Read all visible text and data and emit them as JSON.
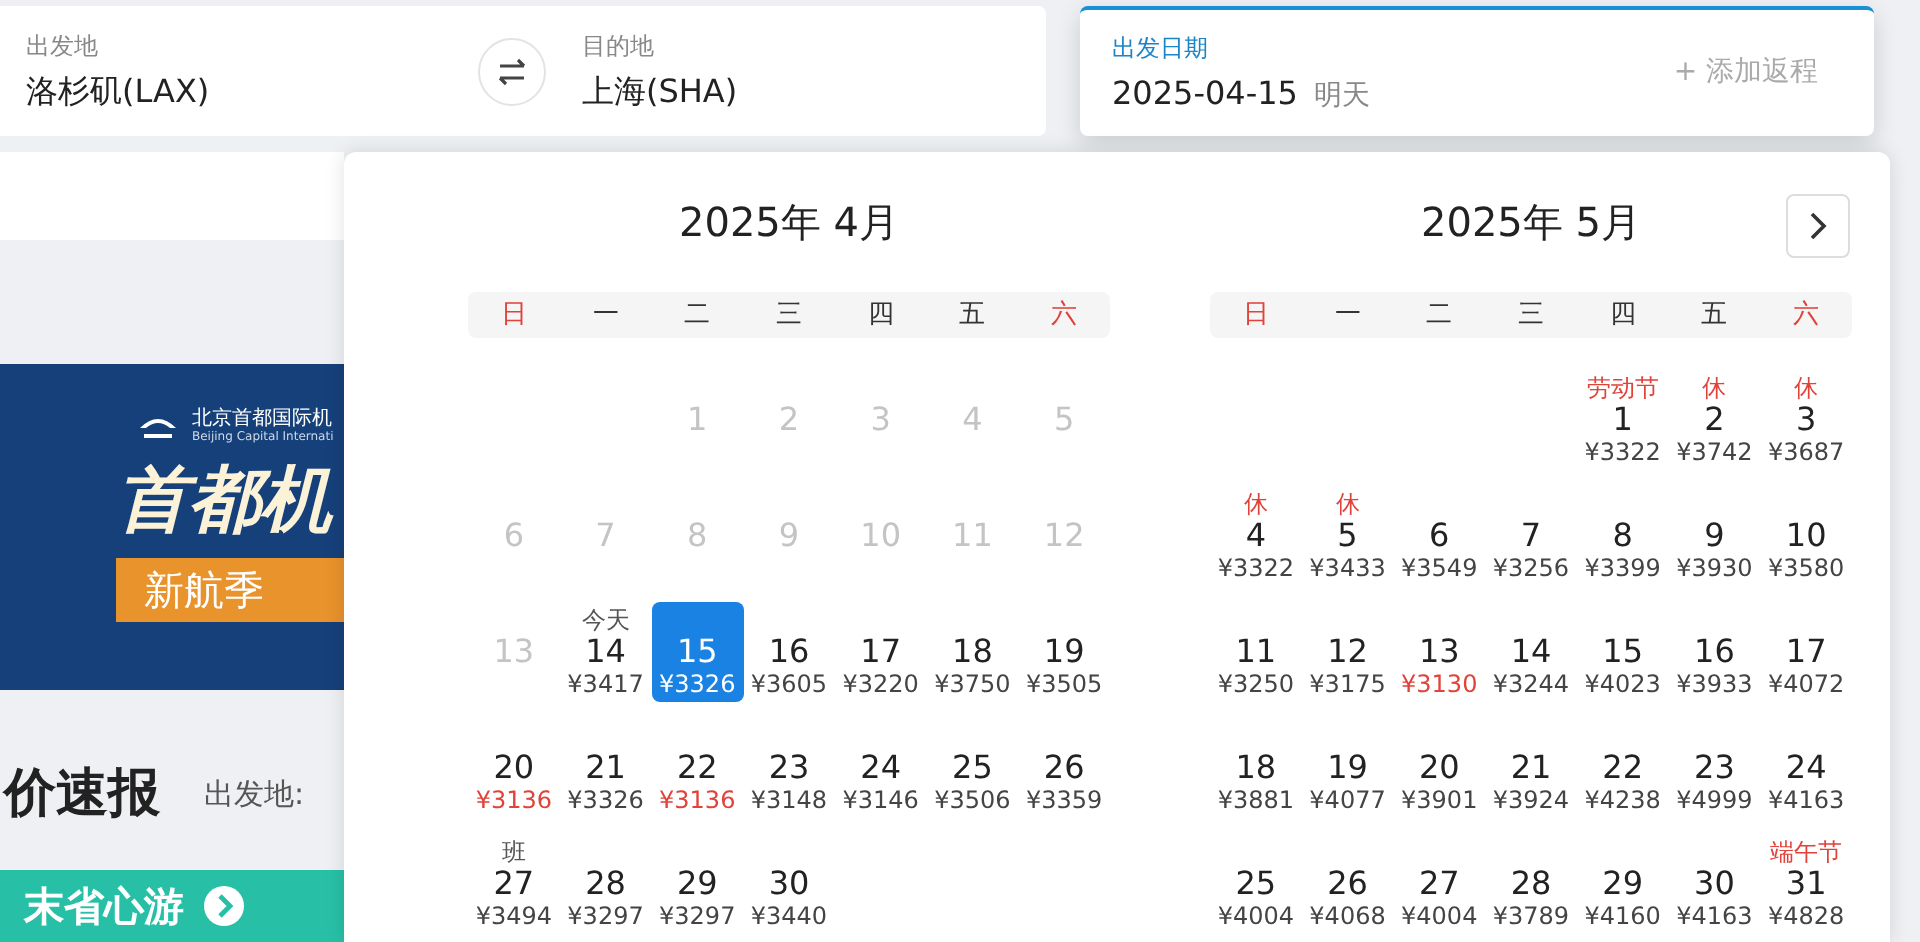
{
  "search": {
    "origin": {
      "label": "出发地",
      "value": "洛杉矶(LAX)"
    },
    "destination": {
      "label": "目的地",
      "value": "上海(SHA)"
    },
    "depart": {
      "label": "出发日期",
      "value": "2025-04-15",
      "hint": "明天",
      "active": true
    },
    "return": {
      "label": "+ 添加返程"
    }
  },
  "page": {
    "banner": {
      "org": "北京首都国际机",
      "org_en": "Beijing Capital Internati",
      "headline": "首都机",
      "tag": "新航季"
    },
    "section_title": "价速报",
    "filter_label": "出发地:",
    "promo": "末省心游"
  },
  "calendar": {
    "months": [
      {
        "title": "2025年 4月",
        "weekdays": [
          {
            "label": "日",
            "weekend": true
          },
          {
            "label": "一",
            "weekend": false
          },
          {
            "label": "二",
            "weekend": false
          },
          {
            "label": "三",
            "weekend": false
          },
          {
            "label": "四",
            "weekend": false
          },
          {
            "label": "五",
            "weekend": false
          },
          {
            "label": "六",
            "weekend": true
          }
        ],
        "weeks": [
          [
            {
              "kind": "blank"
            },
            {
              "kind": "blank"
            },
            {
              "kind": "day",
              "day": "1",
              "disabled": true,
              "selected": false
            },
            {
              "kind": "day",
              "day": "2",
              "disabled": true,
              "selected": false
            },
            {
              "kind": "day",
              "day": "3",
              "disabled": true,
              "selected": false
            },
            {
              "kind": "day",
              "day": "4",
              "disabled": true,
              "selected": false
            },
            {
              "kind": "day",
              "day": "5",
              "disabled": true,
              "selected": false
            }
          ],
          [
            {
              "kind": "day",
              "day": "6",
              "disabled": true,
              "selected": false
            },
            {
              "kind": "day",
              "day": "7",
              "disabled": true,
              "selected": false
            },
            {
              "kind": "day",
              "day": "8",
              "disabled": true,
              "selected": false
            },
            {
              "kind": "day",
              "day": "9",
              "disabled": true,
              "selected": false
            },
            {
              "kind": "day",
              "day": "10",
              "disabled": true,
              "selected": false
            },
            {
              "kind": "day",
              "day": "11",
              "disabled": true,
              "selected": false
            },
            {
              "kind": "day",
              "day": "12",
              "disabled": true,
              "selected": false
            }
          ],
          [
            {
              "kind": "day",
              "day": "13",
              "disabled": true,
              "selected": false
            },
            {
              "kind": "day",
              "day": "14",
              "note": "今天",
              "holiday": false,
              "price": "¥3417",
              "low": false,
              "disabled": false,
              "selected": false
            },
            {
              "kind": "day",
              "day": "15",
              "price": "¥3326",
              "low": false,
              "disabled": false,
              "selected": true
            },
            {
              "kind": "day",
              "day": "16",
              "price": "¥3605",
              "low": false,
              "disabled": false,
              "selected": false
            },
            {
              "kind": "day",
              "day": "17",
              "price": "¥3220",
              "low": false,
              "disabled": false,
              "selected": false
            },
            {
              "kind": "day",
              "day": "18",
              "price": "¥3750",
              "low": false,
              "disabled": false,
              "selected": false
            },
            {
              "kind": "day",
              "day": "19",
              "price": "¥3505",
              "low": false,
              "disabled": false,
              "selected": false
            }
          ],
          [
            {
              "kind": "day",
              "day": "20",
              "price": "¥3136",
              "low": true,
              "disabled": false,
              "selected": false
            },
            {
              "kind": "day",
              "day": "21",
              "price": "¥3326",
              "low": false,
              "disabled": false,
              "selected": false
            },
            {
              "kind": "day",
              "day": "22",
              "price": "¥3136",
              "low": true,
              "disabled": false,
              "selected": false
            },
            {
              "kind": "day",
              "day": "23",
              "price": "¥3148",
              "low": false,
              "disabled": false,
              "selected": false
            },
            {
              "kind": "day",
              "day": "24",
              "price": "¥3146",
              "low": false,
              "disabled": false,
              "selected": false
            },
            {
              "kind": "day",
              "day": "25",
              "price": "¥3506",
              "low": false,
              "disabled": false,
              "selected": false
            },
            {
              "kind": "day",
              "day": "26",
              "price": "¥3359",
              "low": false,
              "disabled": false,
              "selected": false
            }
          ],
          [
            {
              "kind": "day",
              "day": "27",
              "note": "班",
              "holiday": false,
              "price": "¥3494",
              "low": false,
              "disabled": false,
              "selected": false
            },
            {
              "kind": "day",
              "day": "28",
              "price": "¥3297",
              "low": false,
              "disabled": false,
              "selected": false
            },
            {
              "kind": "day",
              "day": "29",
              "price": "¥3297",
              "low": false,
              "disabled": false,
              "selected": false
            },
            {
              "kind": "day",
              "day": "30",
              "price": "¥3440",
              "low": false,
              "disabled": false,
              "selected": false
            }
          ]
        ]
      },
      {
        "title": "2025年 5月",
        "weekdays": [
          {
            "label": "日",
            "weekend": true
          },
          {
            "label": "一",
            "weekend": false
          },
          {
            "label": "二",
            "weekend": false
          },
          {
            "label": "三",
            "weekend": false
          },
          {
            "label": "四",
            "weekend": false
          },
          {
            "label": "五",
            "weekend": false
          },
          {
            "label": "六",
            "weekend": true
          }
        ],
        "weeks": [
          [
            {
              "kind": "blank"
            },
            {
              "kind": "blank"
            },
            {
              "kind": "blank"
            },
            {
              "kind": "blank"
            },
            {
              "kind": "day",
              "day": "1",
              "note": "劳动节",
              "holiday": true,
              "price": "¥3322",
              "low": false,
              "disabled": false,
              "selected": false
            },
            {
              "kind": "day",
              "day": "2",
              "note": "休",
              "holiday": true,
              "price": "¥3742",
              "low": false,
              "disabled": false,
              "selected": false
            },
            {
              "kind": "day",
              "day": "3",
              "note": "休",
              "holiday": true,
              "price": "¥3687",
              "low": false,
              "disabled": false,
              "selected": false
            }
          ],
          [
            {
              "kind": "day",
              "day": "4",
              "note": "休",
              "holiday": true,
              "price": "¥3322",
              "low": false,
              "disabled": false,
              "selected": false
            },
            {
              "kind": "day",
              "day": "5",
              "note": "休",
              "holiday": true,
              "price": "¥3433",
              "low": false,
              "disabled": false,
              "selected": false
            },
            {
              "kind": "day",
              "day": "6",
              "price": "¥3549",
              "low": false,
              "disabled": false,
              "selected": false
            },
            {
              "kind": "day",
              "day": "7",
              "price": "¥3256",
              "low": false,
              "disabled": false,
              "selected": false
            },
            {
              "kind": "day",
              "day": "8",
              "price": "¥3399",
              "low": false,
              "disabled": false,
              "selected": false
            },
            {
              "kind": "day",
              "day": "9",
              "price": "¥3930",
              "low": false,
              "disabled": false,
              "selected": false
            },
            {
              "kind": "day",
              "day": "10",
              "price": "¥3580",
              "low": false,
              "disabled": false,
              "selected": false
            }
          ],
          [
            {
              "kind": "day",
              "day": "11",
              "price": "¥3250",
              "low": false,
              "disabled": false,
              "selected": false
            },
            {
              "kind": "day",
              "day": "12",
              "price": "¥3175",
              "low": false,
              "disabled": false,
              "selected": false
            },
            {
              "kind": "day",
              "day": "13",
              "price": "¥3130",
              "low": true,
              "disabled": false,
              "selected": false
            },
            {
              "kind": "day",
              "day": "14",
              "price": "¥3244",
              "low": false,
              "disabled": false,
              "selected": false
            },
            {
              "kind": "day",
              "day": "15",
              "price": "¥4023",
              "low": false,
              "disabled": false,
              "selected": false
            },
            {
              "kind": "day",
              "day": "16",
              "price": "¥3933",
              "low": false,
              "disabled": false,
              "selected": false
            },
            {
              "kind": "day",
              "day": "17",
              "price": "¥4072",
              "low": false,
              "disabled": false,
              "selected": false
            }
          ],
          [
            {
              "kind": "day",
              "day": "18",
              "price": "¥3881",
              "low": false,
              "disabled": false,
              "selected": false
            },
            {
              "kind": "day",
              "day": "19",
              "price": "¥4077",
              "low": false,
              "disabled": false,
              "selected": false
            },
            {
              "kind": "day",
              "day": "20",
              "price": "¥3901",
              "low": false,
              "disabled": false,
              "selected": false
            },
            {
              "kind": "day",
              "day": "21",
              "price": "¥3924",
              "low": false,
              "disabled": false,
              "selected": false
            },
            {
              "kind": "day",
              "day": "22",
              "price": "¥4238",
              "low": false,
              "disabled": false,
              "selected": false
            },
            {
              "kind": "day",
              "day": "23",
              "price": "¥4999",
              "low": false,
              "disabled": false,
              "selected": false
            },
            {
              "kind": "day",
              "day": "24",
              "price": "¥4163",
              "low": false,
              "disabled": false,
              "selected": false
            }
          ],
          [
            {
              "kind": "day",
              "day": "25",
              "price": "¥4004",
              "low": false,
              "disabled": false,
              "selected": false
            },
            {
              "kind": "day",
              "day": "26",
              "price": "¥4068",
              "low": false,
              "disabled": false,
              "selected": false
            },
            {
              "kind": "day",
              "day": "27",
              "price": "¥4004",
              "low": false,
              "disabled": false,
              "selected": false
            },
            {
              "kind": "day",
              "day": "28",
              "price": "¥3789",
              "low": false,
              "disabled": false,
              "selected": false
            },
            {
              "kind": "day",
              "day": "29",
              "price": "¥4160",
              "low": false,
              "disabled": false,
              "selected": false
            },
            {
              "kind": "day",
              "day": "30",
              "price": "¥4163",
              "low": false,
              "disabled": false,
              "selected": false
            },
            {
              "kind": "day",
              "day": "31",
              "note": "端午节",
              "holiday": true,
              "price": "¥4828",
              "low": false,
              "disabled": false,
              "selected": false
            }
          ]
        ]
      }
    ]
  }
}
